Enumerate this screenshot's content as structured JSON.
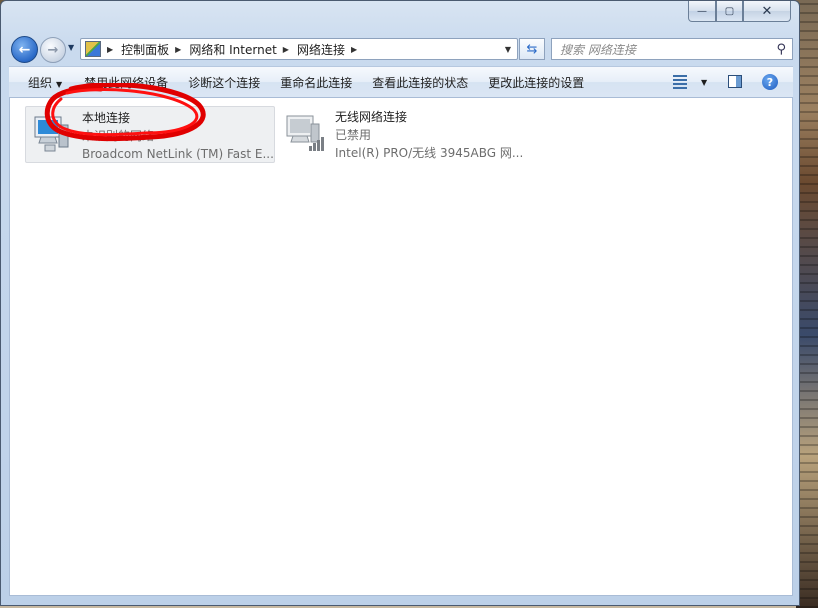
{
  "window": {
    "caption": {
      "minimize": "—",
      "maximize": "▢",
      "close": "✕"
    }
  },
  "nav": {
    "back": "←",
    "forward": "→",
    "breadcrumbs": [
      "控制面板",
      "网络和 Internet",
      "网络连接"
    ],
    "search_placeholder": "搜索 网络连接"
  },
  "toolbar": {
    "organize": "组织",
    "items": [
      "禁用此网络设备",
      "诊断这个连接",
      "重命名此连接",
      "查看此连接的状态",
      "更改此连接的设置"
    ],
    "help": "?"
  },
  "connections": [
    {
      "name": "本地连接",
      "status": "未识别的网络",
      "device": "Broadcom NetLink (TM) Fast E...",
      "selected": true
    },
    {
      "name": "无线网络连接",
      "status": "已禁用",
      "device": "Intel(R) PRO/无线 3945ABG 网...",
      "selected": false
    }
  ]
}
